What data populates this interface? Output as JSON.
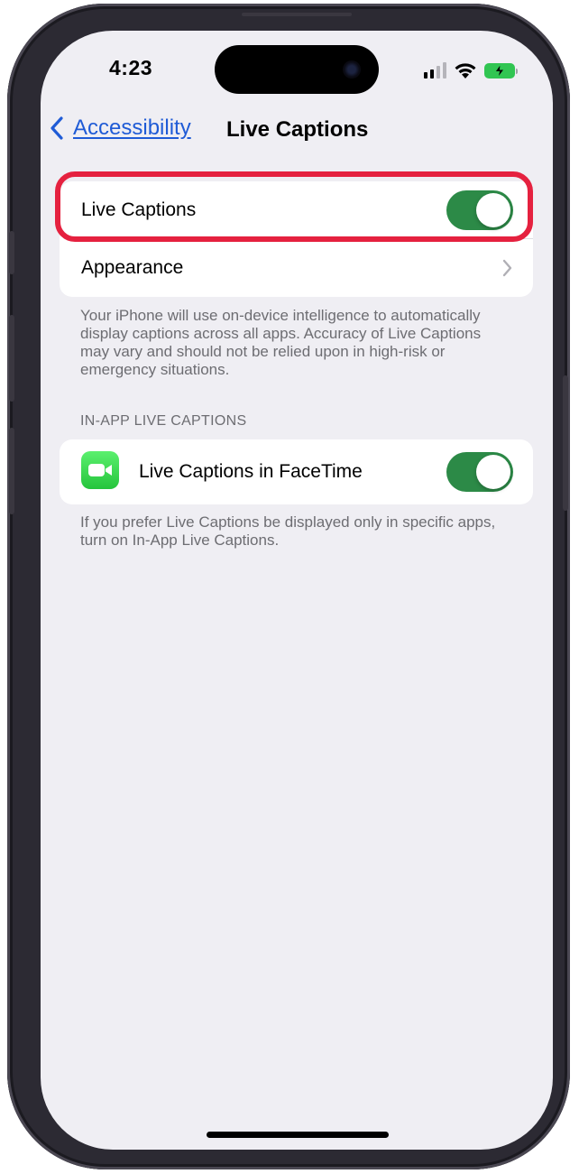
{
  "status_bar": {
    "time": "4:23"
  },
  "nav": {
    "back_label": "Accessibility",
    "title": "Live Captions"
  },
  "main_group": {
    "live_captions": {
      "label": "Live Captions",
      "toggle_on": true
    },
    "appearance": {
      "label": "Appearance"
    }
  },
  "main_footer": "Your iPhone will use on-device intelligence to automatically display captions across all apps. Accuracy of Live Captions may vary and should not be relied upon in high-risk or emergency situations.",
  "in_app_section": {
    "header": "IN-APP LIVE CAPTIONS",
    "facetime": {
      "label": "Live Captions in FaceTime",
      "toggle_on": true,
      "icon": "facetime-icon"
    },
    "footer": "If you prefer Live Captions be displayed only in specific apps, turn on In-App Live Captions."
  },
  "colors": {
    "accent": "#1f5bd6",
    "toggle_on": "#2c8a47",
    "highlight": "#e5213f",
    "background": "#efeef3"
  }
}
